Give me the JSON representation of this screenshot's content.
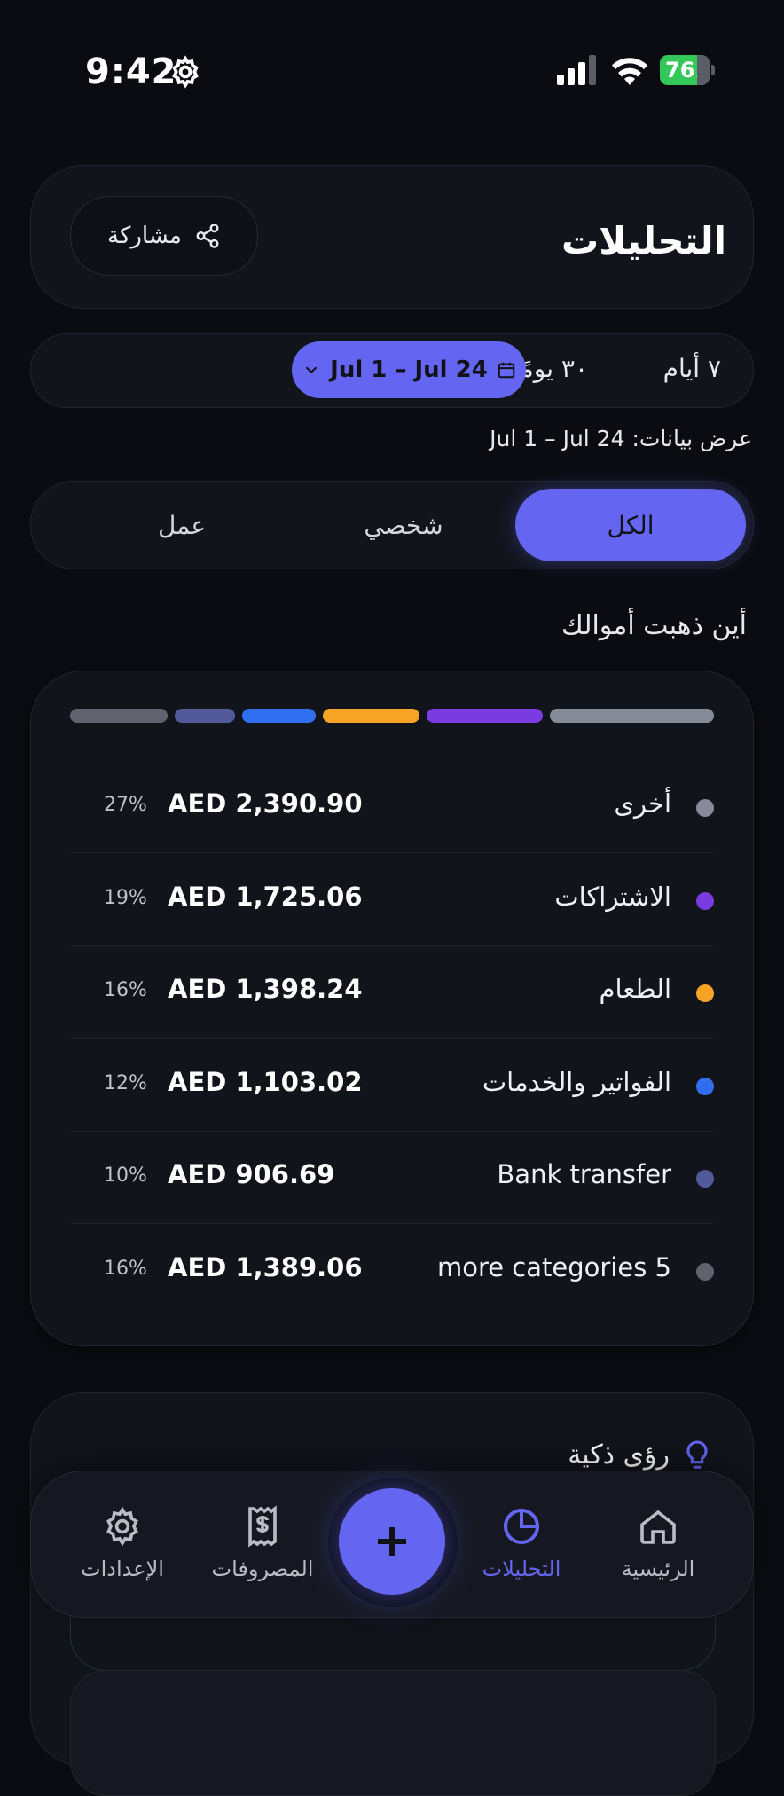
{
  "status_bar": {
    "time": "9:42",
    "battery": "76"
  },
  "header": {
    "title": "التحليلات",
    "share_label": "مشاركة"
  },
  "date_range": {
    "options": [
      "٧ أيام",
      "٣٠ يومًا"
    ],
    "selected": "Jul 1 – Jul 24",
    "showing_label": "عرض بيانات:",
    "showing_value": "Jul 1 – Jul 24"
  },
  "segments": {
    "items": [
      "الكل",
      "شخصي",
      "عمل"
    ],
    "active": "الكل"
  },
  "breakdown": {
    "title": "أين ذهبت أموالك",
    "categories": [
      {
        "name": "أخرى",
        "amount": "AED 2,390.90",
        "percent": "27%",
        "share": 27,
        "color": "#868b97"
      },
      {
        "name": "الاشتراكات",
        "amount": "AED 1,725.06",
        "percent": "19%",
        "share": 19,
        "color": "#7a3be0"
      },
      {
        "name": "الطعام",
        "amount": "AED 1,398.24",
        "percent": "16%",
        "share": 16,
        "color": "#f7a325"
      },
      {
        "name": "الفواتير والخدمات",
        "amount": "AED 1,103.02",
        "percent": "12%",
        "share": 12,
        "color": "#2f6ff0"
      },
      {
        "name": "Bank transfer",
        "amount": "AED 906.69",
        "percent": "10%",
        "share": 10,
        "color": "#525a99"
      },
      {
        "name": "more categories 5",
        "amount": "AED 1,389.06",
        "percent": "16%",
        "share": 16,
        "color": "#60636d"
      }
    ]
  },
  "insights": {
    "title": "رؤى ذكية"
  },
  "tabbar": {
    "home": "الرئيسية",
    "analytics": "التحليلات",
    "expenses": "المصروفات",
    "settings": "الإعدادات",
    "active": "analytics"
  },
  "colors": {
    "accent": "#6466f1",
    "background": "#0b0c11",
    "card": "#12141c"
  }
}
